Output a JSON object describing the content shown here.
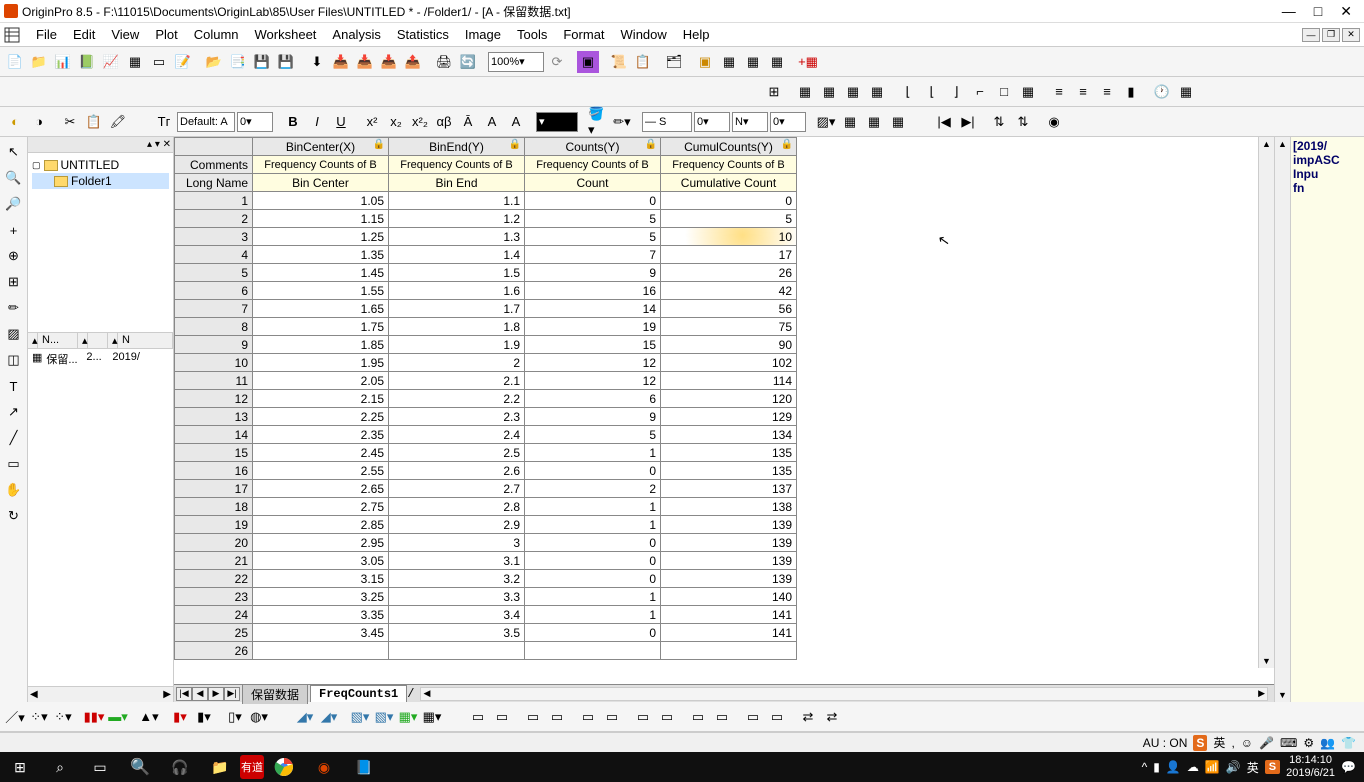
{
  "title": "OriginPro 8.5 - F:\\11015\\Documents\\OriginLab\\85\\User Files\\UNTITLED * - /Folder1/ - [A - 保留数据.txt]",
  "menus": [
    "File",
    "Edit",
    "View",
    "Plot",
    "Column",
    "Worksheet",
    "Analysis",
    "Statistics",
    "Image",
    "Tools",
    "Format",
    "Window",
    "Help"
  ],
  "zoom": "100%",
  "font_default": "Default: A",
  "font_size": "0",
  "project": {
    "root": "UNTITLED",
    "folder": "Folder1",
    "list_cols": [
      "N...",
      "",
      "N"
    ],
    "list_row": {
      "name": "保留...",
      "s": "2...",
      "m": "2019/"
    }
  },
  "worksheet": {
    "cols": [
      "BinCenter(X)",
      "BinEnd(Y)",
      "Counts(Y)",
      "CumulCounts(Y)"
    ],
    "comments_label": "Comments",
    "comment": "Frequency Counts of B",
    "longname_label": "Long Name",
    "longnames": [
      "Bin Center",
      "Bin End",
      "Count",
      "Cumulative Count"
    ],
    "data": [
      [
        1,
        "1.05",
        "1.1",
        "0",
        "0"
      ],
      [
        2,
        "1.15",
        "1.2",
        "5",
        "5"
      ],
      [
        3,
        "1.25",
        "1.3",
        "5",
        "10"
      ],
      [
        4,
        "1.35",
        "1.4",
        "7",
        "17"
      ],
      [
        5,
        "1.45",
        "1.5",
        "9",
        "26"
      ],
      [
        6,
        "1.55",
        "1.6",
        "16",
        "42"
      ],
      [
        7,
        "1.65",
        "1.7",
        "14",
        "56"
      ],
      [
        8,
        "1.75",
        "1.8",
        "19",
        "75"
      ],
      [
        9,
        "1.85",
        "1.9",
        "15",
        "90"
      ],
      [
        10,
        "1.95",
        "2",
        "12",
        "102"
      ],
      [
        11,
        "2.05",
        "2.1",
        "12",
        "114"
      ],
      [
        12,
        "2.15",
        "2.2",
        "6",
        "120"
      ],
      [
        13,
        "2.25",
        "2.3",
        "9",
        "129"
      ],
      [
        14,
        "2.35",
        "2.4",
        "5",
        "134"
      ],
      [
        15,
        "2.45",
        "2.5",
        "1",
        "135"
      ],
      [
        16,
        "2.55",
        "2.6",
        "0",
        "135"
      ],
      [
        17,
        "2.65",
        "2.7",
        "2",
        "137"
      ],
      [
        18,
        "2.75",
        "2.8",
        "1",
        "138"
      ],
      [
        19,
        "2.85",
        "2.9",
        "1",
        "139"
      ],
      [
        20,
        "2.95",
        "3",
        "0",
        "139"
      ],
      [
        21,
        "3.05",
        "3.1",
        "0",
        "139"
      ],
      [
        22,
        "3.15",
        "3.2",
        "0",
        "139"
      ],
      [
        23,
        "3.25",
        "3.3",
        "1",
        "140"
      ],
      [
        24,
        "3.35",
        "3.4",
        "1",
        "141"
      ],
      [
        25,
        "3.45",
        "3.5",
        "0",
        "141"
      ],
      [
        26,
        "",
        "",
        "",
        ""
      ]
    ],
    "tabs": [
      "保留数据",
      "FreqCounts1"
    ]
  },
  "script_panel": [
    "[2019/",
    "impASC",
    " Inpu",
    "  fn"
  ],
  "status": {
    "au": "AU : ON",
    "ime": "英"
  },
  "format_toolbar": {
    "line_style": "— S",
    "num1": "0",
    "num2": "0",
    "letter": "N"
  },
  "taskbar": {
    "time": "18:14:10",
    "date": "2019/6/21",
    "lang": "英",
    "ime_indicator": "S"
  }
}
